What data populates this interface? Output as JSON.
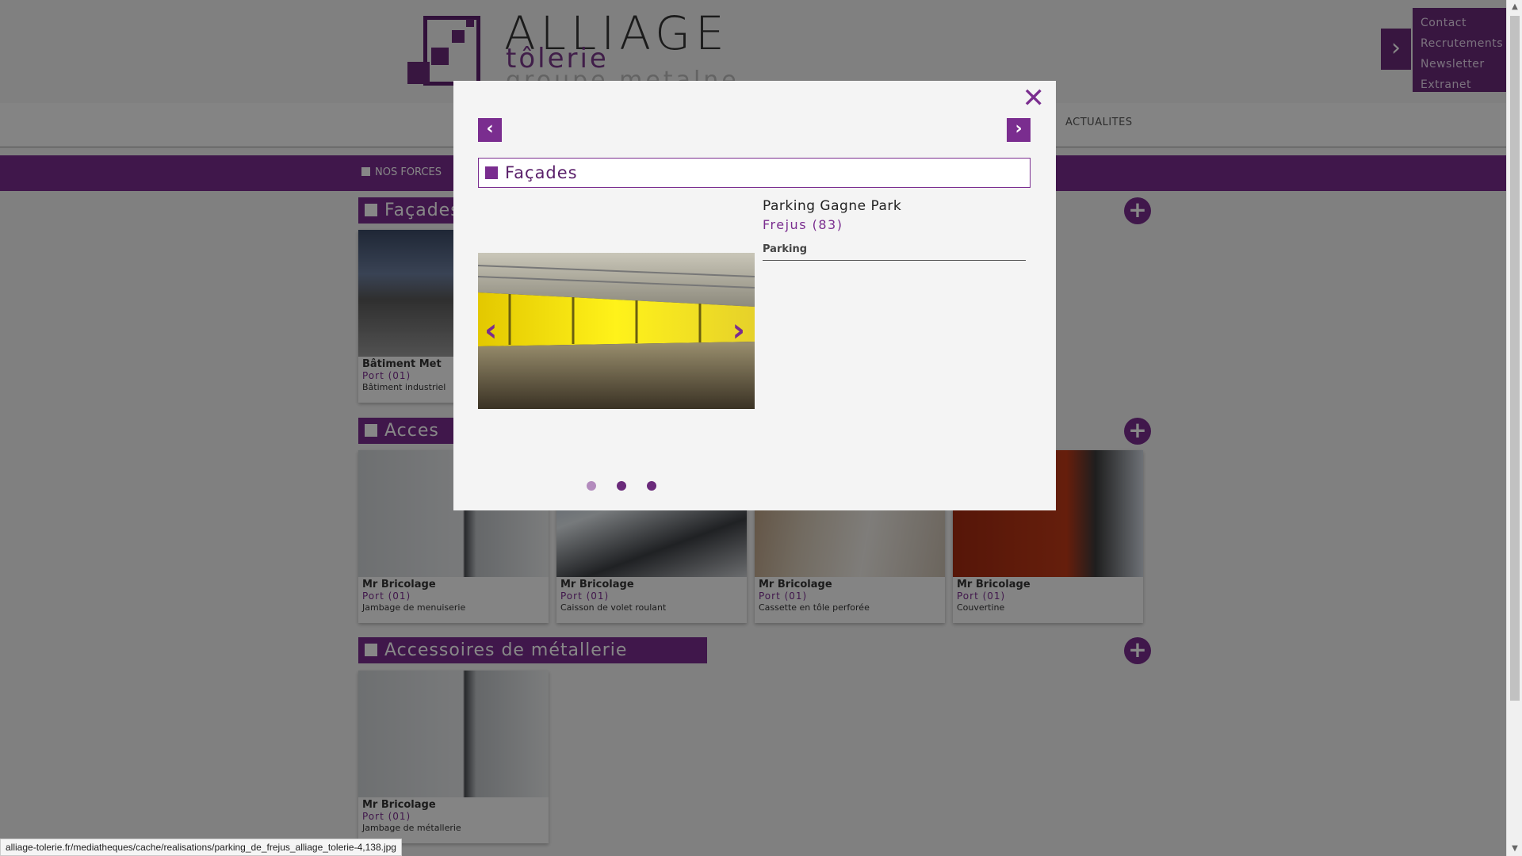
{
  "brand": {
    "title": "ALLIAGE",
    "subtitle": "tôlerie",
    "subtitle2": "groupe metalne"
  },
  "top_links": [
    "Contact",
    "Recrutements",
    "Newsletter",
    "Extranet"
  ],
  "main_nav": {
    "actualites": "ACTUALITES"
  },
  "sub_nav": {
    "nos_forces": "NOS FORCES"
  },
  "sections": [
    {
      "title": "Façades",
      "cards": [
        {
          "title": "Bâtiment Met",
          "location": "Port (01)",
          "description": "Bâtiment industriel"
        }
      ]
    },
    {
      "title": "Acces",
      "cards": [
        {
          "title": "Mr Bricolage",
          "location": "Port (01)",
          "description": "Jambage de menuiserie"
        },
        {
          "title": "Mr Bricolage",
          "location": "Port (01)",
          "description": "Caisson de volet roulant"
        },
        {
          "title": "Mr Bricolage",
          "location": "Port (01)",
          "description": "Cassette en tôle perforée"
        },
        {
          "title": "Mr Bricolage",
          "location": "Port (01)",
          "description": "Couvertine"
        }
      ]
    },
    {
      "title": "Accessoires de métallerie",
      "cards": [
        {
          "title": "Mr Bricolage",
          "location": "Port (01)",
          "description": "Jambage de métallerie"
        }
      ]
    }
  ],
  "modal": {
    "close": "✕",
    "prev": "‹",
    "next": "›",
    "category": "Façades",
    "project_name": "Parking Gagne Park",
    "project_location": "Frejus (83)",
    "project_type": "Parking",
    "photo_prev": "‹",
    "photo_next": "›",
    "slide_count": 3,
    "active_slide": 1
  },
  "status_url": "alliage-tolerie.fr/mediatheques/cache/realisations/parking_de_frejus_alliage_tolerie-4,138.jpg",
  "colors": {
    "accent": "#7a2d8f",
    "accent_dark": "#5a1f6a",
    "modal_bg": "#f4f4f4"
  }
}
